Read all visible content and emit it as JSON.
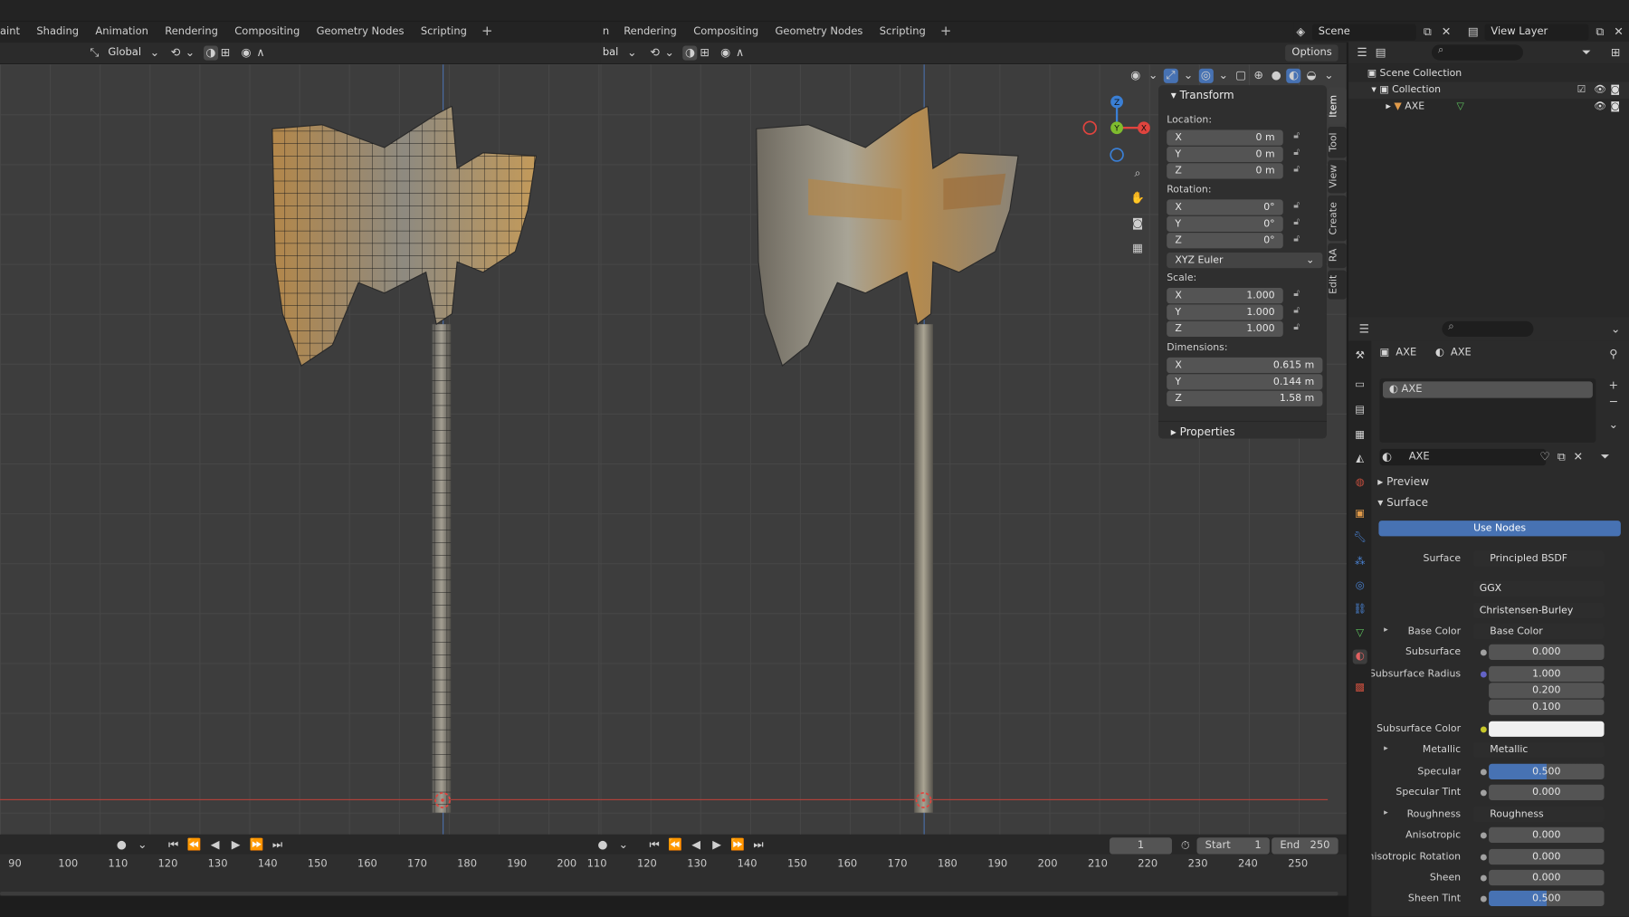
{
  "workspace_tabs_left": [
    "aint",
    "Shading",
    "Animation",
    "Rendering",
    "Compositing",
    "Geometry Nodes",
    "Scripting",
    "+"
  ],
  "workspace_tabs_right": [
    "n",
    "Rendering",
    "Compositing",
    "Geometry Nodes",
    "Scripting",
    "+"
  ],
  "scene": {
    "label": "Scene",
    "view_layer": "View Layer"
  },
  "viewport_left": {
    "orientation": "Global"
  },
  "viewport_right": {
    "orientation": "bal",
    "options": "Options"
  },
  "gizmo": {
    "x": "X",
    "y": "Y",
    "z": "Z"
  },
  "npanel": {
    "transform_header": "Transform",
    "location_label": "Location:",
    "location": [
      {
        "axis": "X",
        "value": "0 m"
      },
      {
        "axis": "Y",
        "value": "0 m"
      },
      {
        "axis": "Z",
        "value": "0 m"
      }
    ],
    "rotation_label": "Rotation:",
    "rotation": [
      {
        "axis": "X",
        "value": "0°"
      },
      {
        "axis": "Y",
        "value": "0°"
      },
      {
        "axis": "Z",
        "value": "0°"
      }
    ],
    "rotation_mode": "XYZ Euler",
    "scale_label": "Scale:",
    "scale": [
      {
        "axis": "X",
        "value": "1.000"
      },
      {
        "axis": "Y",
        "value": "1.000"
      },
      {
        "axis": "Z",
        "value": "1.000"
      }
    ],
    "dimensions_label": "Dimensions:",
    "dimensions": [
      {
        "axis": "X",
        "value": "0.615 m"
      },
      {
        "axis": "Y",
        "value": "0.144 m"
      },
      {
        "axis": "Z",
        "value": "1.58 m"
      }
    ],
    "properties_header": "Properties",
    "side_tabs": [
      "Item",
      "Tool",
      "View",
      "Create",
      "RA",
      "Edit"
    ]
  },
  "outliner": {
    "scene_collection": "Scene Collection",
    "collection": "Collection",
    "object": "AXE"
  },
  "properties": {
    "breadcrumb_object": "AXE",
    "breadcrumb_material": "AXE",
    "slot": "AXE",
    "material_name": "AXE",
    "preview": "Preview",
    "surface_header": "Surface",
    "use_nodes": "Use Nodes",
    "surface_label": "Surface",
    "surface_value": "Principled BSDF",
    "distribution": "GGX",
    "subsurface_method": "Christensen-Burley",
    "rows": [
      {
        "label": "Base Color",
        "value": "Base Color",
        "linked": true,
        "arrow": true
      },
      {
        "label": "Subsurface",
        "value": "0.000"
      },
      {
        "label": "Subsurface Radius",
        "values": [
          "1.000",
          "0.200",
          "0.100"
        ]
      },
      {
        "label": "Subsurface Color",
        "value": ""
      },
      {
        "label": "Metallic",
        "value": "Metallic",
        "linked": true,
        "arrow": true
      },
      {
        "label": "Specular",
        "value": "0.500"
      },
      {
        "label": "Specular Tint",
        "value": "0.000"
      },
      {
        "label": "Roughness",
        "value": "Roughness",
        "linked": true,
        "arrow": true
      },
      {
        "label": "Anisotropic",
        "value": "0.000"
      },
      {
        "label": "Anisotropic Rotation",
        "value": "0.000"
      },
      {
        "label": "Sheen",
        "value": "0.000"
      },
      {
        "label": "Sheen Tint",
        "value": "0.500"
      }
    ],
    "specular_fill": 0.5
  },
  "timeline": {
    "current_frame": "1",
    "start_label": "Start",
    "start": "1",
    "end_label": "End",
    "end": "250",
    "ticks_left": [
      "90",
      "100",
      "110",
      "120",
      "130",
      "140",
      "150",
      "160",
      "170",
      "180",
      "190",
      "200"
    ],
    "ticks_right": [
      "110",
      "120",
      "130",
      "140",
      "150",
      "160",
      "170",
      "180",
      "190",
      "200",
      "210",
      "220",
      "230",
      "240",
      "250"
    ]
  },
  "colors": {
    "accent": "#4772b3",
    "header": "#2b2b2b",
    "viewport": "#3d3d3d",
    "x_axis": "#e0443e",
    "y_axis": "#7fbc2e",
    "z_axis": "#3a7fd5"
  }
}
